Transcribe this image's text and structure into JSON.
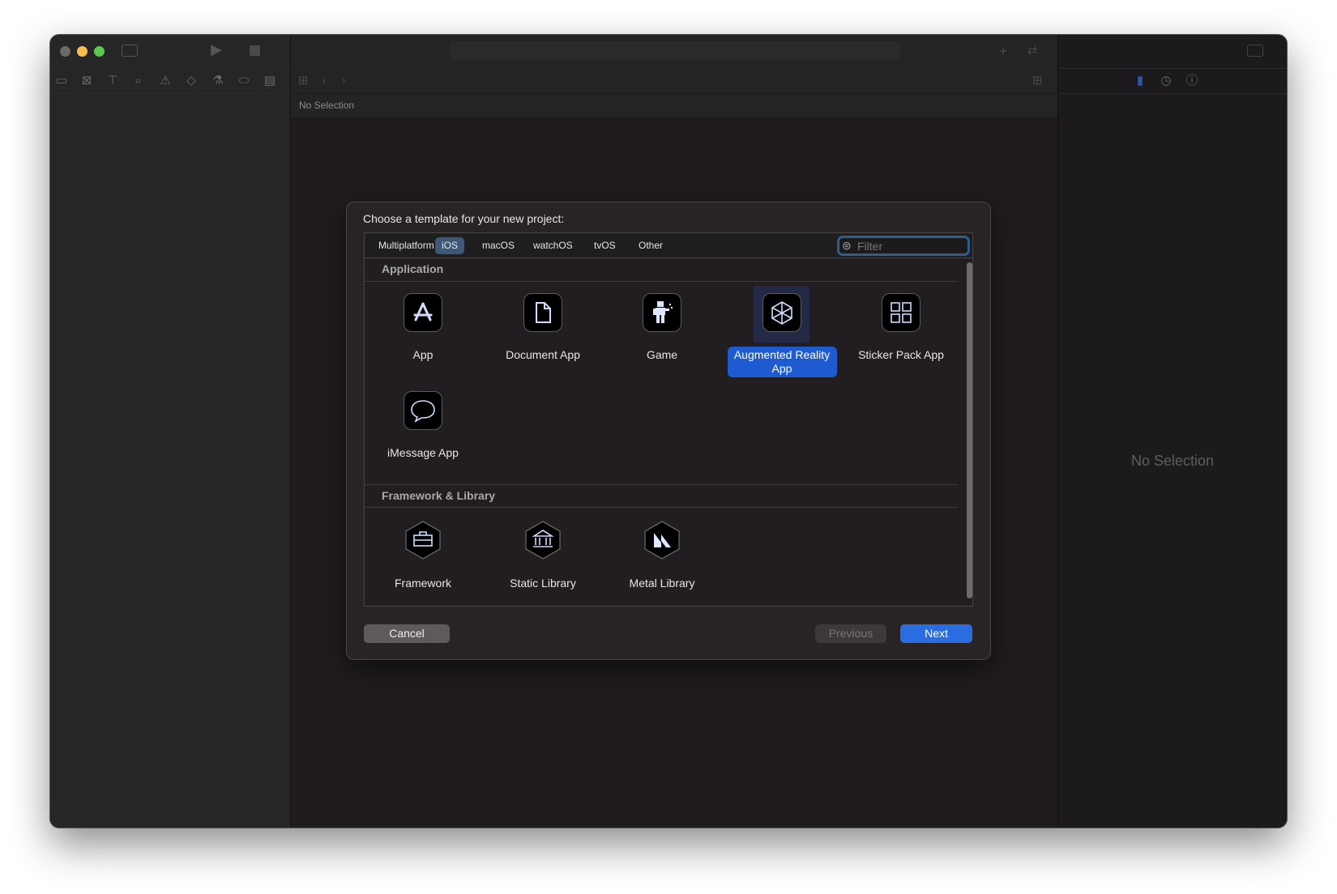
{
  "window": {
    "traffic_lights": {
      "close": "#6a6a6a",
      "minimize": "#f5bf4f",
      "zoom": "#5fc751"
    },
    "navigator_icons": [
      "folder-icon",
      "source-control-icon",
      "hierarchy-icon",
      "search-icon",
      "warning-icon",
      "test-icon",
      "debug-icon",
      "breakpoint-icon",
      "report-icon"
    ],
    "editor_status": "No Selection",
    "inspector_placeholder": "No Selection"
  },
  "dialog": {
    "title": "Choose a template for your new project:",
    "tabs": [
      {
        "label": "Multiplatform",
        "active": false
      },
      {
        "label": "iOS",
        "active": true
      },
      {
        "label": "macOS",
        "active": false
      },
      {
        "label": "watchOS",
        "active": false
      },
      {
        "label": "tvOS",
        "active": false
      },
      {
        "label": "Other",
        "active": false
      }
    ],
    "filter_placeholder": "Filter",
    "sections": [
      {
        "title": "Application",
        "items": [
          {
            "label": "App",
            "icon": "app-store-icon"
          },
          {
            "label": "Document App",
            "icon": "document-icon"
          },
          {
            "label": "Game",
            "icon": "game-robot-icon"
          },
          {
            "label": "Augmented Reality App",
            "icon": "ar-cube-icon",
            "selected": true
          },
          {
            "label": "Sticker Pack App",
            "icon": "sticker-grid-icon"
          },
          {
            "label": "iMessage App",
            "icon": "message-bubble-icon"
          }
        ]
      },
      {
        "title": "Framework & Library",
        "items": [
          {
            "label": "Framework",
            "icon": "toolbox-icon"
          },
          {
            "label": "Static Library",
            "icon": "library-building-icon"
          },
          {
            "label": "Metal Library",
            "icon": "metal-icon"
          }
        ]
      }
    ],
    "buttons": {
      "cancel": "Cancel",
      "previous": "Previous",
      "next": "Next"
    },
    "accent": "#1f5bd0"
  }
}
